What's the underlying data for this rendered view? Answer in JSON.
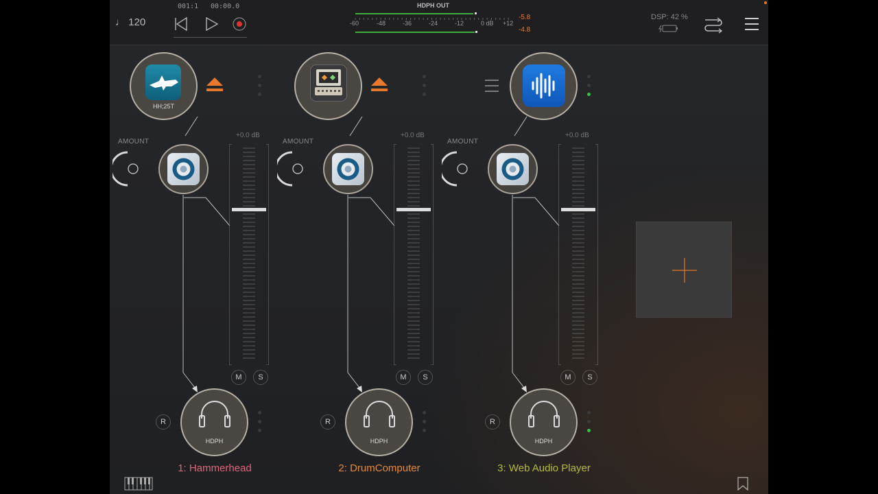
{
  "transport": {
    "tempo_icon": "note-icon",
    "tempo": "120",
    "position": "001:1",
    "time": "00:00.0"
  },
  "meter": {
    "title": "HDPH OUT",
    "ticks": [
      "-60",
      "-48",
      "-36",
      "-24",
      "-12",
      "0 dB",
      "+12"
    ],
    "peak_top": "-5.8",
    "peak_bottom": "-4.8"
  },
  "status": {
    "dsp": "DSP: 42 %"
  },
  "channels": [
    {
      "name": "1: Hammerhead",
      "name_color": "#e0667a",
      "slot_label": "HH;25T",
      "amount_label": "AMOUNT",
      "gain_label": "+0.0 dB",
      "mute": "M",
      "solo": "S",
      "record": "R",
      "output": "HDPH"
    },
    {
      "name": "2: DrumComputer",
      "name_color": "#e58a38",
      "slot_label": "",
      "amount_label": "AMOUNT",
      "gain_label": "+0.0 dB",
      "mute": "M",
      "solo": "S",
      "record": "R",
      "output": "HDPH"
    },
    {
      "name": "3: Web Audio Player",
      "name_color": "#b5bb3c",
      "slot_label": "",
      "amount_label": "AMOUNT",
      "gain_label": "+0.0 dB",
      "mute": "M",
      "solo": "S",
      "record": "R",
      "output": "HDPH"
    }
  ],
  "add_channel": {
    "icon": "plus-icon"
  },
  "colors": {
    "accent": "#e8792c",
    "active_led": "#37c04a",
    "meter_green": "#3fae3f"
  }
}
